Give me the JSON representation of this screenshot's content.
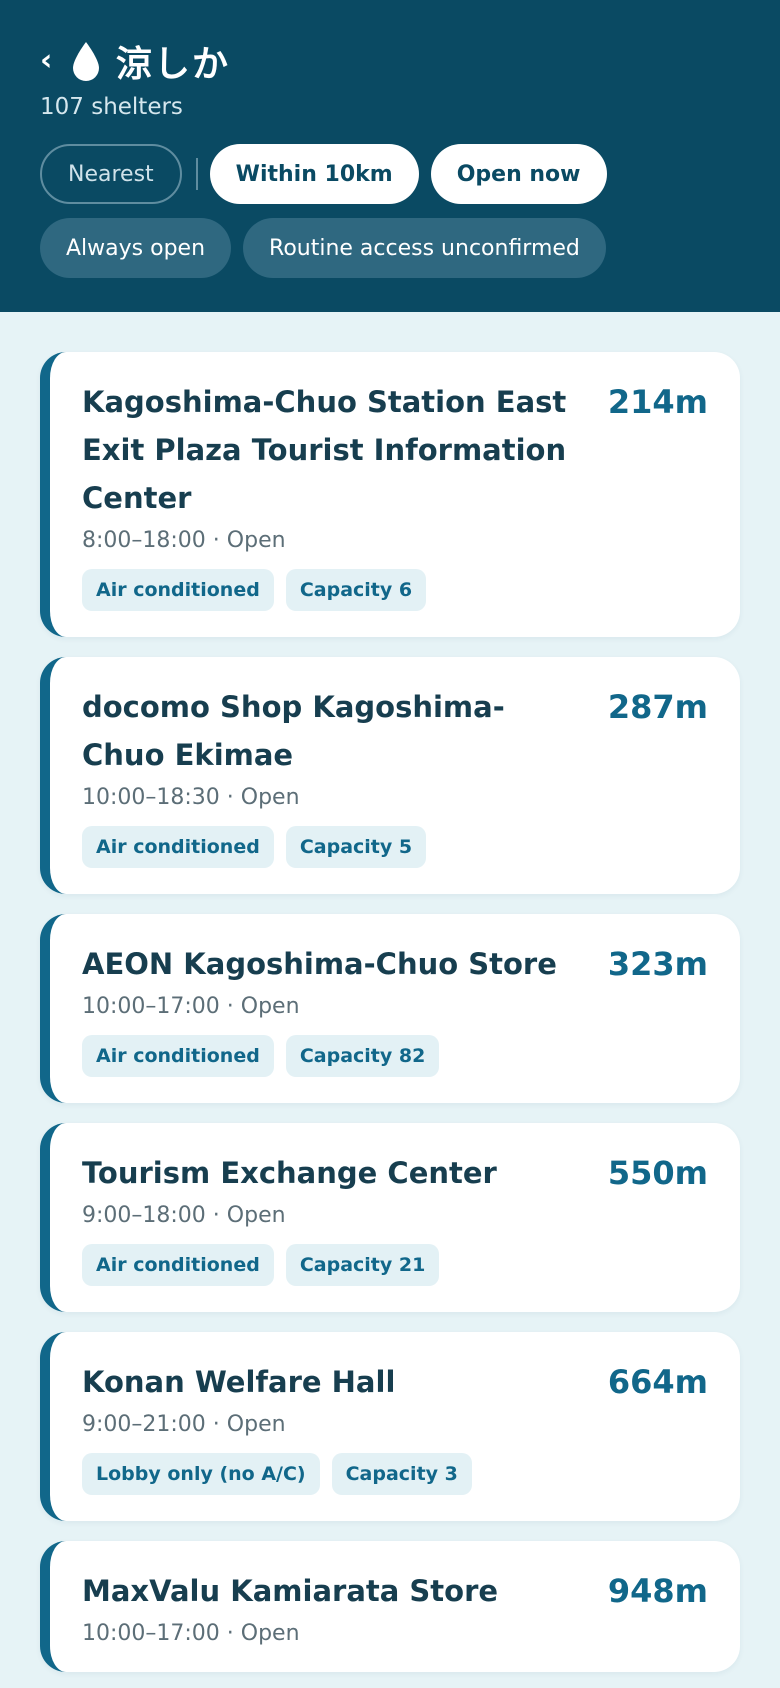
{
  "header": {
    "back_label": "‹",
    "app_title": "涼しか",
    "shelter_count": "107 shelters",
    "colors": {
      "background": "#0a4a63",
      "accent": "#11678a"
    }
  },
  "filters": {
    "sort": "Nearest",
    "toggles": [
      "Within 10km",
      "Open now"
    ],
    "options": [
      "Always open",
      "Routine access unconfirmed"
    ]
  },
  "shelters": [
    {
      "name": "Kagoshima-Chuo Station East Exit Plaza Tourist Information Center",
      "distance": "214m",
      "hours": "8:00–18:00 · Open",
      "tags": [
        "Air conditioned",
        "Capacity 6"
      ]
    },
    {
      "name": "docomo Shop Kagoshima-Chuo Ekimae",
      "distance": "287m",
      "hours": "10:00–18:30 · Open",
      "tags": [
        "Air conditioned",
        "Capacity 5"
      ]
    },
    {
      "name": "AEON Kagoshima-Chuo Store",
      "distance": "323m",
      "hours": "10:00–17:00 · Open",
      "tags": [
        "Air conditioned",
        "Capacity 82"
      ]
    },
    {
      "name": "Tourism Exchange Center",
      "distance": "550m",
      "hours": "9:00–18:00 · Open",
      "tags": [
        "Air conditioned",
        "Capacity 21"
      ]
    },
    {
      "name": "Konan Welfare Hall",
      "distance": "664m",
      "hours": "9:00–21:00 · Open",
      "tags": [
        "Lobby only (no A/C)",
        "Capacity 3"
      ]
    },
    {
      "name": "MaxValu Kamiarata Store",
      "distance": "948m",
      "hours": "10:00–17:00 · Open",
      "tags": []
    }
  ]
}
